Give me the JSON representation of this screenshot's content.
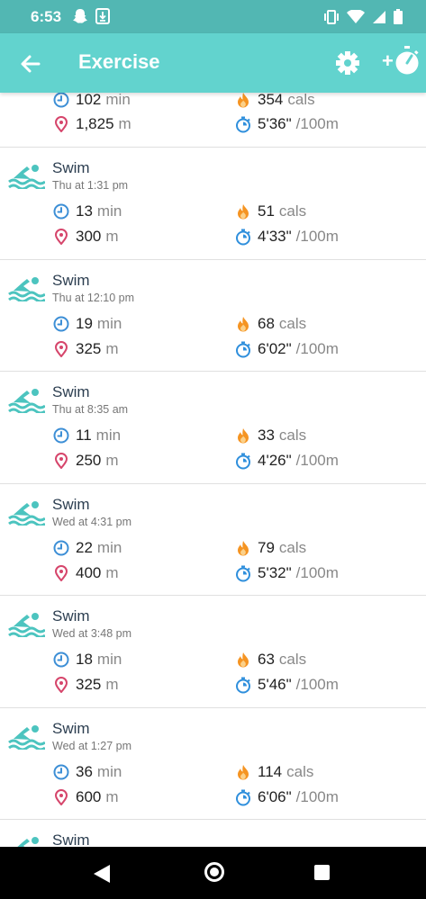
{
  "status": {
    "time": "6:53"
  },
  "header": {
    "title": "Exercise",
    "add_label": "+"
  },
  "partial_row": {
    "duration": "102",
    "duration_unit": "min",
    "distance": "1,825",
    "distance_unit": "m",
    "calories": "354",
    "calories_unit": "cals",
    "pace": "5'36\"",
    "pace_unit": "/100m"
  },
  "rows": [
    {
      "title": "Swim",
      "sub": "Thu at 1:31 pm",
      "duration": "13",
      "duration_unit": "min",
      "distance": "300",
      "distance_unit": "m",
      "calories": "51",
      "calories_unit": "cals",
      "pace": "4'33\"",
      "pace_unit": "/100m"
    },
    {
      "title": "Swim",
      "sub": "Thu at 12:10 pm",
      "duration": "19",
      "duration_unit": "min",
      "distance": "325",
      "distance_unit": "m",
      "calories": "68",
      "calories_unit": "cals",
      "pace": "6'02\"",
      "pace_unit": "/100m"
    },
    {
      "title": "Swim",
      "sub": "Thu at 8:35 am",
      "duration": "11",
      "duration_unit": "min",
      "distance": "250",
      "distance_unit": "m",
      "calories": "33",
      "calories_unit": "cals",
      "pace": "4'26\"",
      "pace_unit": "/100m"
    },
    {
      "title": "Swim",
      "sub": "Wed at 4:31 pm",
      "duration": "22",
      "duration_unit": "min",
      "distance": "400",
      "distance_unit": "m",
      "calories": "79",
      "calories_unit": "cals",
      "pace": "5'32\"",
      "pace_unit": "/100m"
    },
    {
      "title": "Swim",
      "sub": "Wed at 3:48 pm",
      "duration": "18",
      "duration_unit": "min",
      "distance": "325",
      "distance_unit": "m",
      "calories": "63",
      "calories_unit": "cals",
      "pace": "5'46\"",
      "pace_unit": "/100m"
    },
    {
      "title": "Swim",
      "sub": "Wed at 1:27 pm",
      "duration": "36",
      "duration_unit": "min",
      "distance": "600",
      "distance_unit": "m",
      "calories": "114",
      "calories_unit": "cals",
      "pace": "6'06\"",
      "pace_unit": "/100m"
    }
  ],
  "last_row": {
    "title": "Swim"
  },
  "colors": {
    "header_bg": "#62d3ce",
    "status_bg": "#52b7b3",
    "swim_icon": "#4cc4bf",
    "clock_icon": "#3d8fd6",
    "pin_icon": "#d6456b",
    "flame_icon": "#f59422",
    "stopwatch_icon": "#2f8fdc"
  }
}
